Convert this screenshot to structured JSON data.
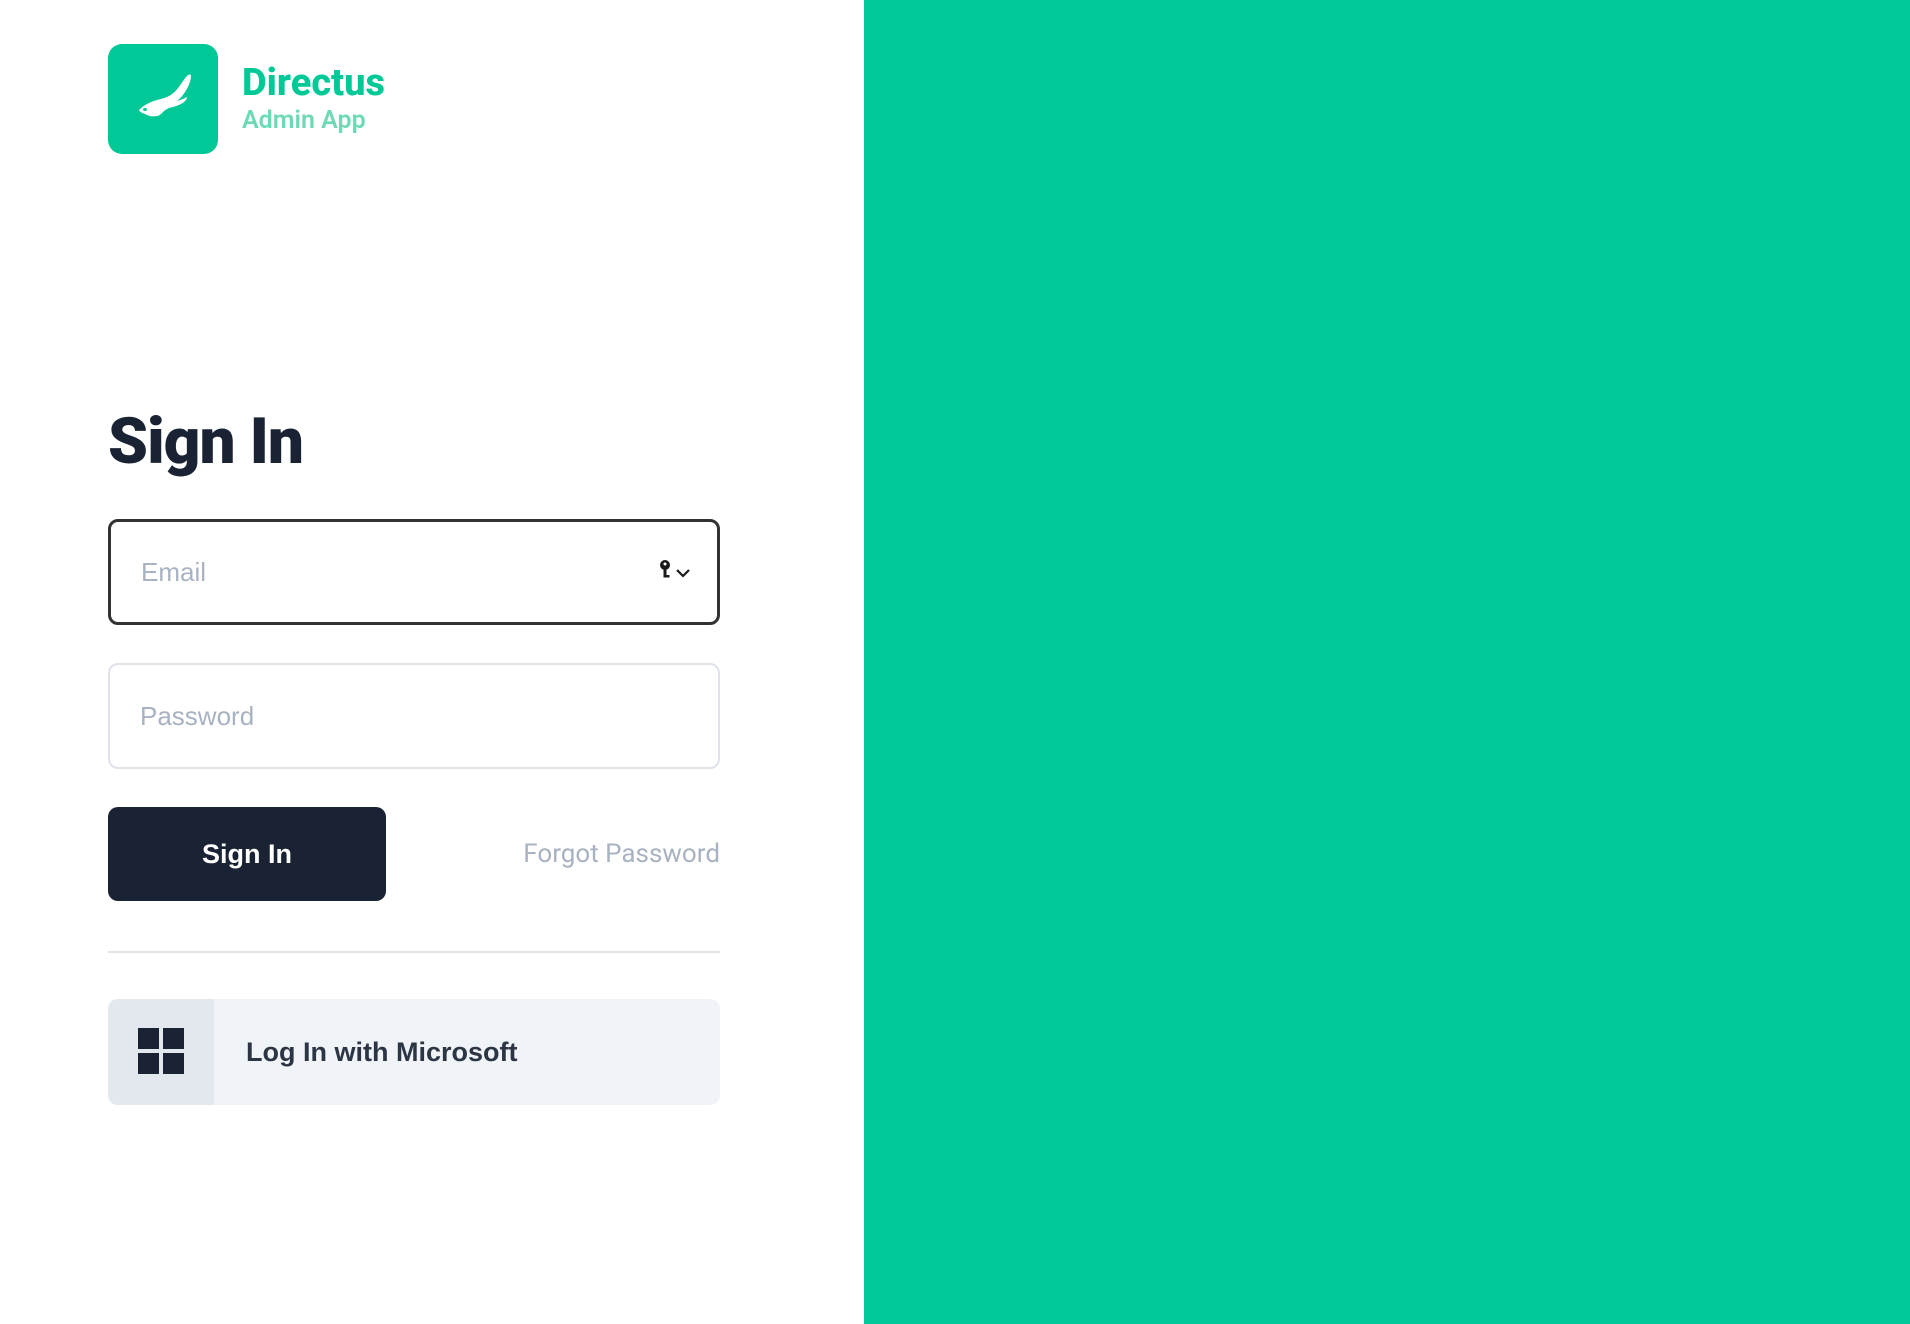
{
  "brand": {
    "title": "Directus",
    "subtitle": "Admin App"
  },
  "page": {
    "heading": "Sign In"
  },
  "form": {
    "email_placeholder": "Email",
    "password_placeholder": "Password",
    "submit_label": "Sign In",
    "forgot_label": "Forgot Password"
  },
  "sso": {
    "microsoft_label": "Log In with Microsoft"
  },
  "colors": {
    "accent": "#00c897",
    "dark": "#1a2333"
  }
}
